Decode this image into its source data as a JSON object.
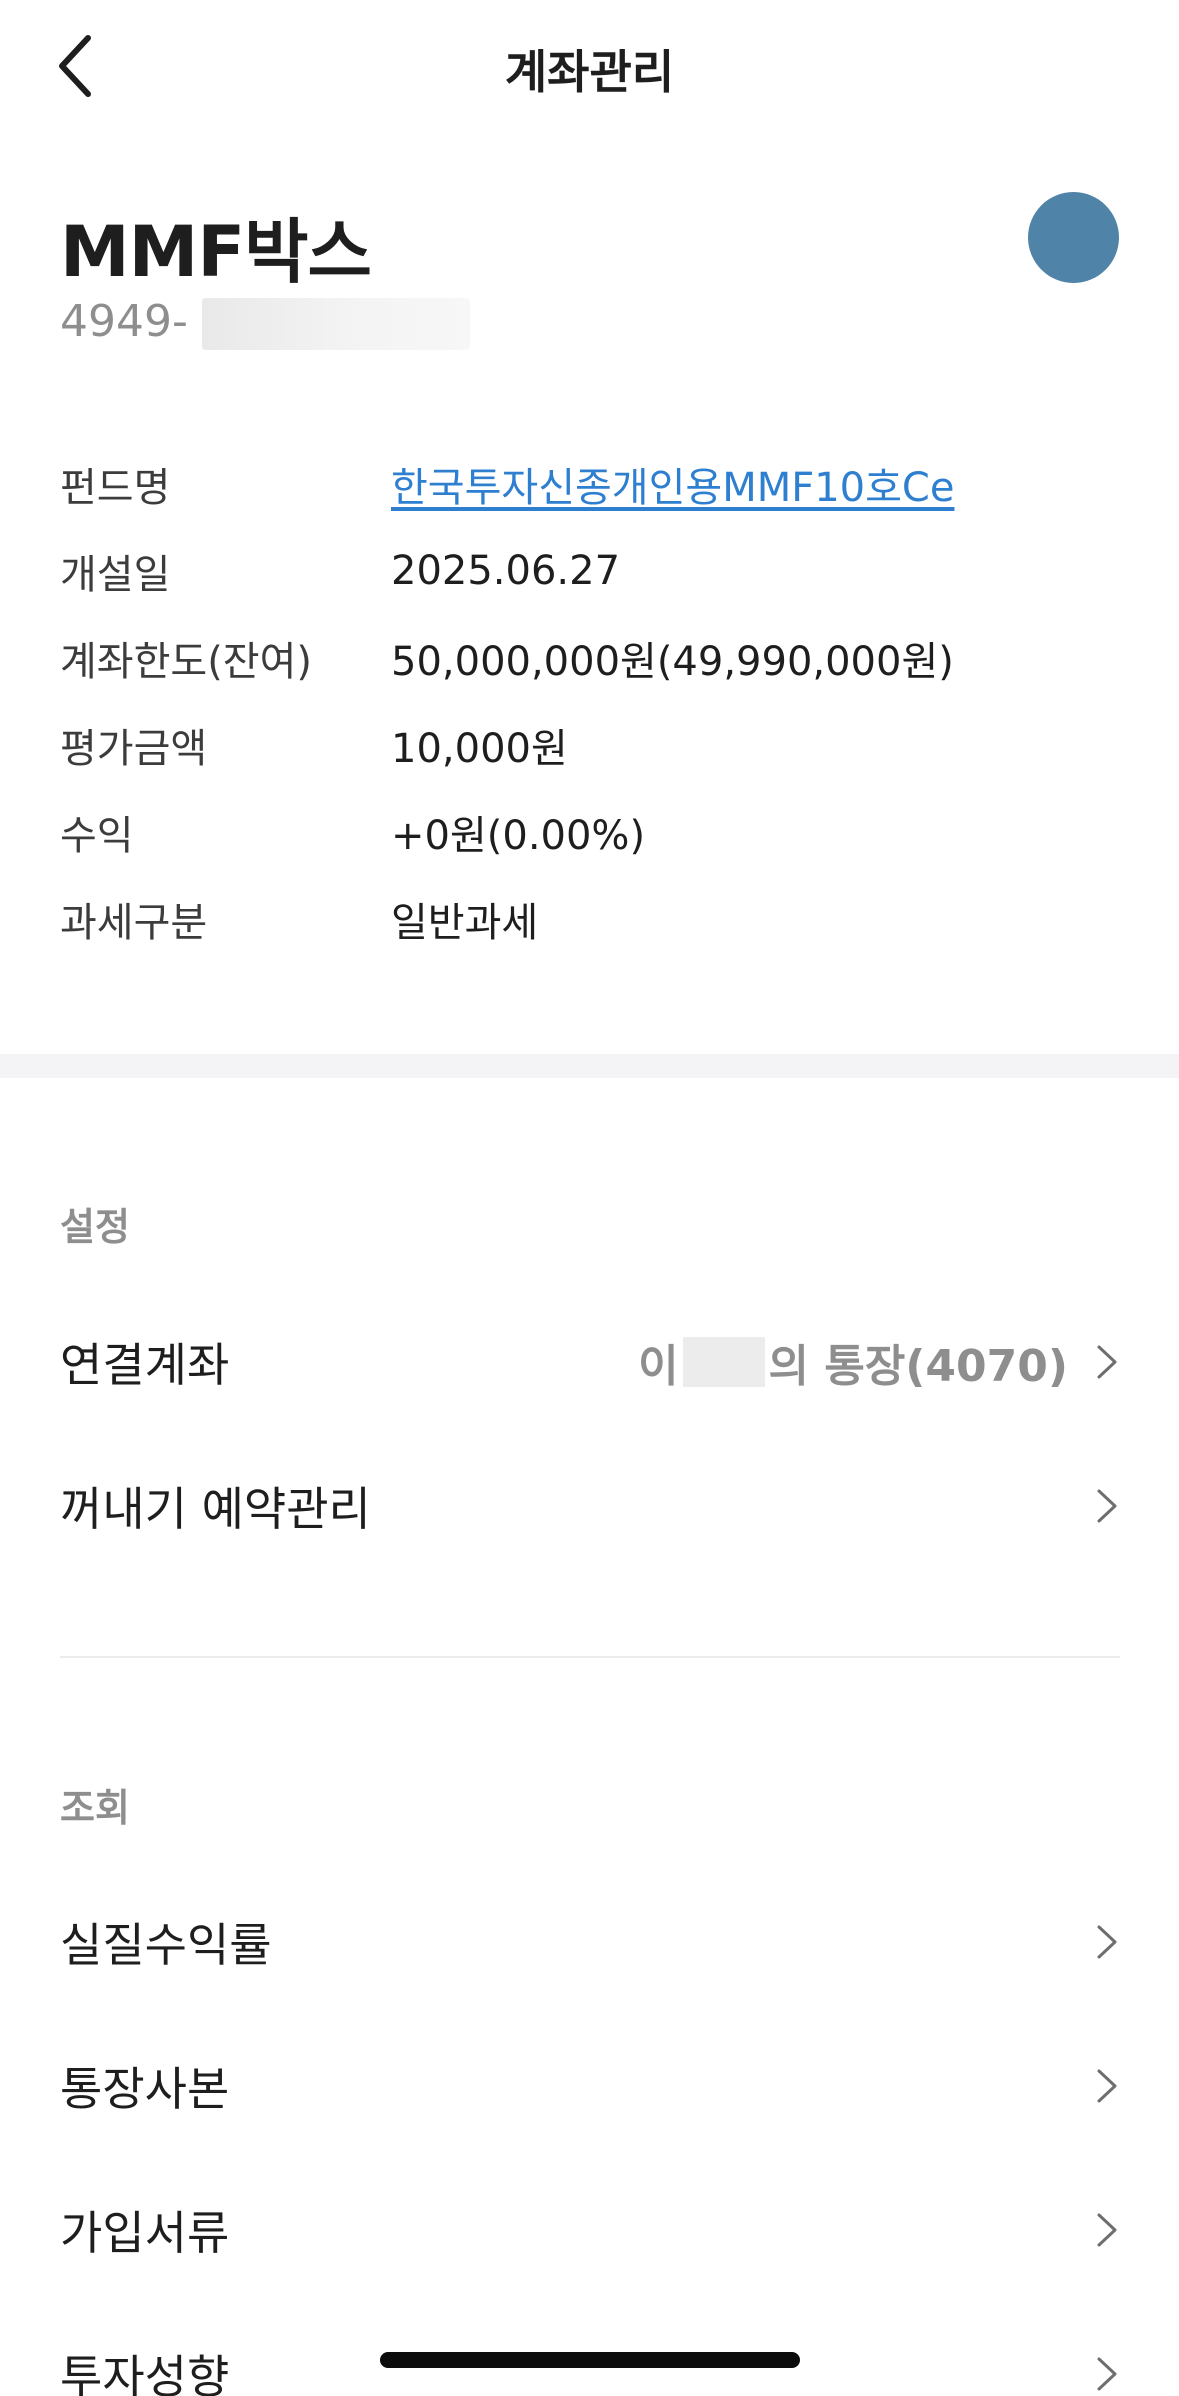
{
  "header": {
    "title": "계좌관리"
  },
  "account": {
    "name": "MMF박스",
    "number_prefix": "4949-"
  },
  "info": [
    {
      "label": "펀드명",
      "value": "한국투자신종개인용MMF10호Ce"
    },
    {
      "label": "개설일",
      "value": "2025.06.27"
    },
    {
      "label": "계좌한도(잔여)",
      "value": "50,000,000원(49,990,000원)"
    },
    {
      "label": "평가금액",
      "value": "10,000원"
    },
    {
      "label": "수익",
      "value": "+0원(0.00%)"
    },
    {
      "label": "과세구분",
      "value": "일반과세"
    }
  ],
  "settings": {
    "title": "설정",
    "linked_account": {
      "label": "연결계좌",
      "value_prefix": "이",
      "value_suffix": "의 통장(4070)"
    },
    "withdraw_schedule": {
      "label": "꺼내기 예약관리"
    }
  },
  "inquiry": {
    "title": "조회",
    "items": [
      {
        "label": "실질수익률"
      },
      {
        "label": "통장사본"
      },
      {
        "label": "가입서류"
      },
      {
        "label": "투자성향"
      }
    ]
  },
  "colors": {
    "link": "#2f7fd1",
    "avatar": "#4f83a7",
    "muted": "#8e8e8e"
  }
}
